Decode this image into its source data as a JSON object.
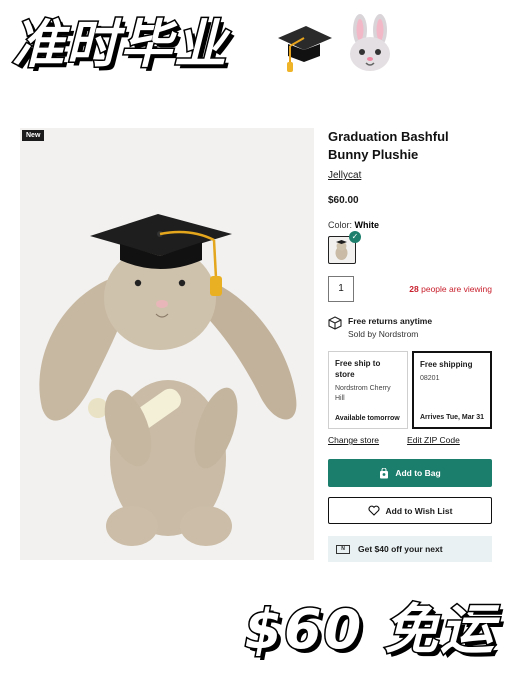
{
  "overlay": {
    "top_title": "准时毕业",
    "bottom_title": "$60 免运",
    "icons": [
      "graduation-cap-emoji",
      "rabbit-face-emoji"
    ]
  },
  "product": {
    "badge": "New",
    "title": "Graduation Bashful Bunny Plushie",
    "brand": "Jellycat",
    "price": "$60.00",
    "color_label": "Color:",
    "color_value": "White",
    "quantity": "1",
    "viewing_count": "28",
    "viewing_text": "people are viewing"
  },
  "returns": {
    "title": "Free returns anytime",
    "sold_by": "Sold by Nordstrom"
  },
  "shipping": {
    "store_option": {
      "heading": "Free ship to store",
      "store": "Nordstrom Cherry Hill",
      "availability": "Available tomorrow"
    },
    "home_option": {
      "heading": "Free shipping",
      "zip": "08201",
      "arrival": "Arrives Tue, Mar 31"
    },
    "change_store": "Change store",
    "edit_zip": "Edit ZIP Code"
  },
  "actions": {
    "add_to_bag": "Add to Bag",
    "wish_list": "Add to Wish List",
    "promo_card": "N",
    "promo": "Get $40 off your next"
  },
  "colors": {
    "accent": "#1b7d6b",
    "alert": "#c8202d",
    "promo_bg": "#e9f1f3"
  }
}
